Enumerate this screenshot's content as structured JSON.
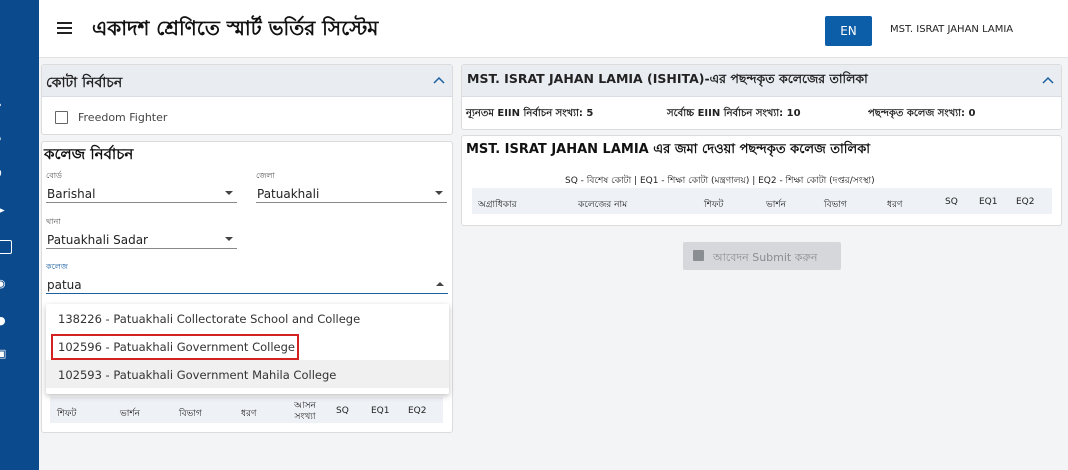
{
  "header": {
    "title": "একাদশ শ্রেণিতে স্মার্ট ভর্তির সিস্টেম",
    "lang_button": "EN",
    "user_name": "MST. ISRAT JAHAN LAMIA"
  },
  "quota": {
    "title": "কোটা নির্বাচন",
    "freedom_fighter_label": "Freedom Fighter"
  },
  "college_select": {
    "title": "কলেজ নির্বাচন",
    "board_label": "বোর্ড",
    "board_value": "Barishal",
    "district_label": "জেলা",
    "district_value": "Patuakhali",
    "thana_label": "থানা",
    "thana_value": "Patuakhali Sadar",
    "college_label": "কলেজ",
    "college_value": "patua",
    "options": [
      "138226 - Patuakhali Collectorate School and College",
      "102596 - Patuakhali Government College",
      "102593 - Patuakhali Government Mahila College"
    ],
    "table_headers": [
      "শিফট",
      "ভার্শন",
      "বিভাগ",
      "ধরণ",
      "আসন সংখ্যা",
      "SQ",
      "EQ1",
      "EQ2"
    ]
  },
  "preferred": {
    "title": "MST. ISRAT JAHAN LAMIA (ISHITA)-এর পছন্দকৃত কলেজের তালিকা",
    "min_eiin": "ন্যূনতম EIIN নির্বাচন সংখ্যা: 5",
    "max_eiin": "সর্বোচ্চ EIIN নির্বাচন সংখ্যা: 10",
    "chosen_count": "পছন্দকৃত কলেজ সংখ্যা: 0"
  },
  "submitted": {
    "title": "MST. ISRAT JAHAN LAMIA এর জমা দেওয়া পছন্দকৃত কলেজ তালিকা",
    "legend": "SQ - বিশেষ কোটা  | EQ1 - শিক্ষা কোটা (মন্ত্রণালয়)  | EQ2 - শিক্ষা কোটা (দপ্তর/সংস্থা)",
    "table_headers": [
      "অগ্রাধিকার",
      "কলেজের নাম",
      "শিফট",
      "ভার্শন",
      "বিভাগ",
      "ধরণ",
      "SQ",
      "EQ1",
      "EQ2"
    ]
  },
  "submit_button": "আবেদন Submit করুন",
  "colors": {
    "sidebar": "#0b4a8c",
    "accent": "#0d5ea8",
    "highlight": "#d32222"
  }
}
